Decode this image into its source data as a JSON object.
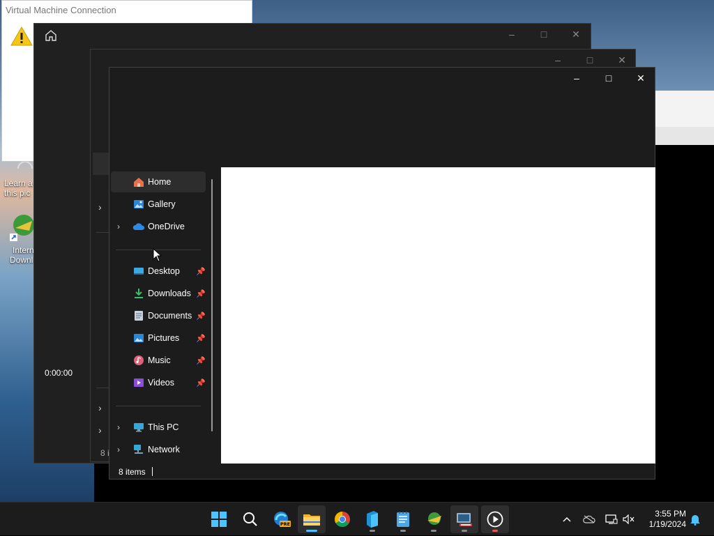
{
  "vm_window": {
    "title": "Virtual Machine Connection"
  },
  "desktop": {
    "icon_partial_1_line1": "Learn a",
    "icon_partial_1_line2": "this pic",
    "icon_partial_2_line1": "Intern",
    "icon_partial_2_line2": "Downl"
  },
  "window_back": {
    "timer": "0:00:00"
  },
  "window_mid": {
    "status_partial": "8 i"
  },
  "explorer": {
    "nav": [
      {
        "label": "Home",
        "icon": "home-icon",
        "selected": true
      },
      {
        "label": "Gallery",
        "icon": "gallery-icon"
      },
      {
        "label": "OneDrive",
        "icon": "cloud-icon",
        "expandable": true
      },
      {
        "label": "Desktop",
        "icon": "desktop-icon",
        "pinned": true
      },
      {
        "label": "Downloads",
        "icon": "download-icon",
        "pinned": true
      },
      {
        "label": "Documents",
        "icon": "document-icon",
        "pinned": true
      },
      {
        "label": "Pictures",
        "icon": "pictures-icon",
        "pinned": true
      },
      {
        "label": "Music",
        "icon": "music-icon",
        "pinned": true
      },
      {
        "label": "Videos",
        "icon": "videos-icon",
        "pinned": true
      },
      {
        "label": "This PC",
        "icon": "computer-icon",
        "expandable": true
      },
      {
        "label": "Network",
        "icon": "network-icon",
        "expandable": true
      }
    ],
    "status": "8 items"
  },
  "taskbar": {
    "apps": [
      "start-icon",
      "search-icon",
      "edge-pre-icon",
      "file-explorer-icon",
      "chrome-icon",
      "app-icon",
      "notepad-icon",
      "internet-download-manager-icon",
      "hyper-v-icon",
      "media-player-icon"
    ],
    "edge_badge": "PRE",
    "clock": {
      "time": "3:55 PM",
      "date": "1/19/2024"
    }
  },
  "colors": {
    "accent": "#4cc2ff",
    "dark_bg": "#1c1c1c",
    "selected_bg": "#2d2d2d"
  }
}
